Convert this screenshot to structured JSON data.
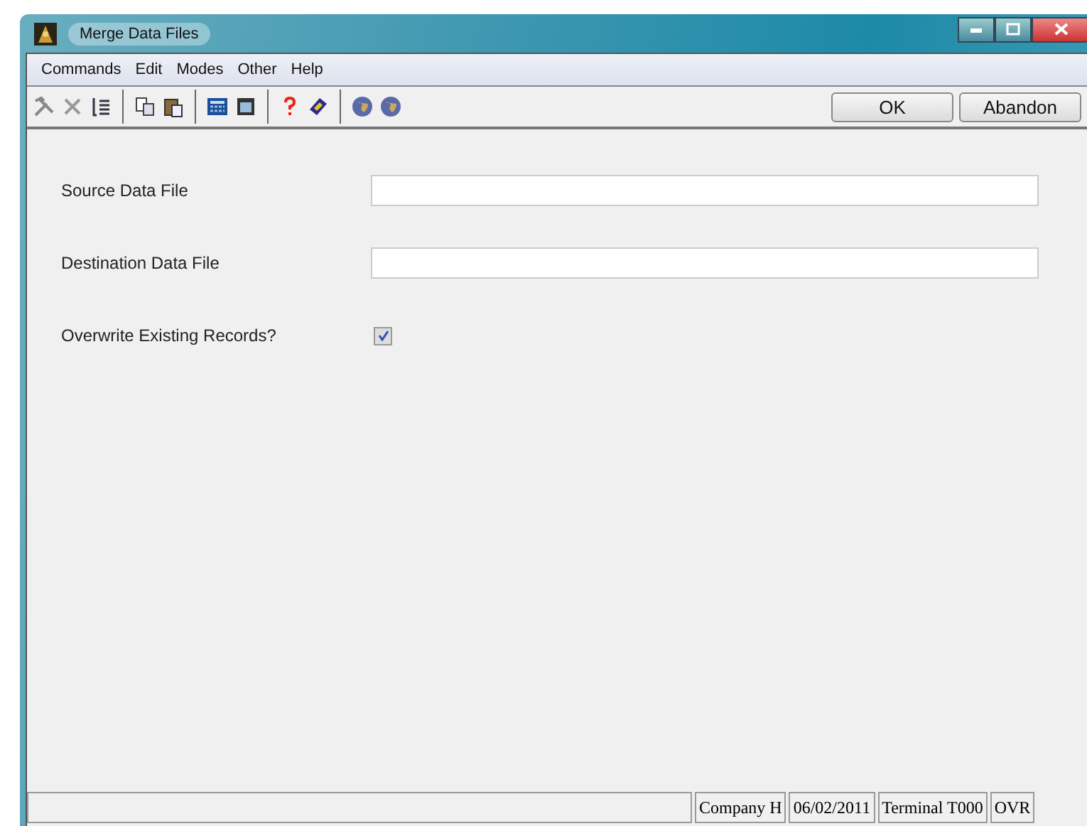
{
  "window": {
    "title": "Merge Data Files"
  },
  "menu": [
    "Commands",
    "Edit",
    "Modes",
    "Other",
    "Help"
  ],
  "buttons": [
    {
      "label": "OK"
    },
    {
      "label": "Abandon"
    }
  ],
  "fields": [
    {
      "label": "Source Data File",
      "kind": "text"
    },
    {
      "label": "Destination Data File",
      "kind": "text"
    },
    {
      "label": "Overwrite Existing Records?",
      "kind": "checkbox",
      "checked": true
    }
  ],
  "status_bar": [
    "Company H",
    "06/02/2011",
    "Terminal T000",
    "OVR"
  ]
}
